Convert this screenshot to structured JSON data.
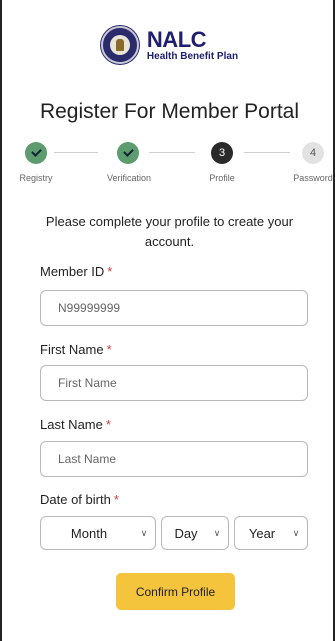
{
  "brand": {
    "name": "NALC",
    "subtitle": "Health Benefit Plan"
  },
  "page": {
    "title": "Register For Member Portal",
    "intro": "Please complete your profile to create your account."
  },
  "steps": [
    {
      "label": "Registry",
      "state": "done",
      "number": ""
    },
    {
      "label": "Verification",
      "state": "done",
      "number": ""
    },
    {
      "label": "Profile",
      "state": "current",
      "number": "3"
    },
    {
      "label": "Password",
      "state": "todo",
      "number": "4"
    }
  ],
  "form": {
    "member_id": {
      "label": "Member ID",
      "required": "*",
      "value": "N99999999"
    },
    "first_name": {
      "label": "First Name",
      "required": "*",
      "placeholder": "First Name"
    },
    "last_name": {
      "label": "Last Name",
      "required": "*",
      "placeholder": "Last Name"
    },
    "dob": {
      "label": "Date of birth",
      "required": "*",
      "month": "Month",
      "day": "Day",
      "year": "Year"
    },
    "confirm_label": "Confirm Profile"
  },
  "colors": {
    "accent": "#f3c43c",
    "done": "#5c9c6e",
    "current": "#2a2a2a",
    "required": "#d23b3b",
    "brand": "#1f1f6e"
  },
  "icons": {
    "chevron": "chevron-down-icon",
    "check": "check-icon"
  }
}
